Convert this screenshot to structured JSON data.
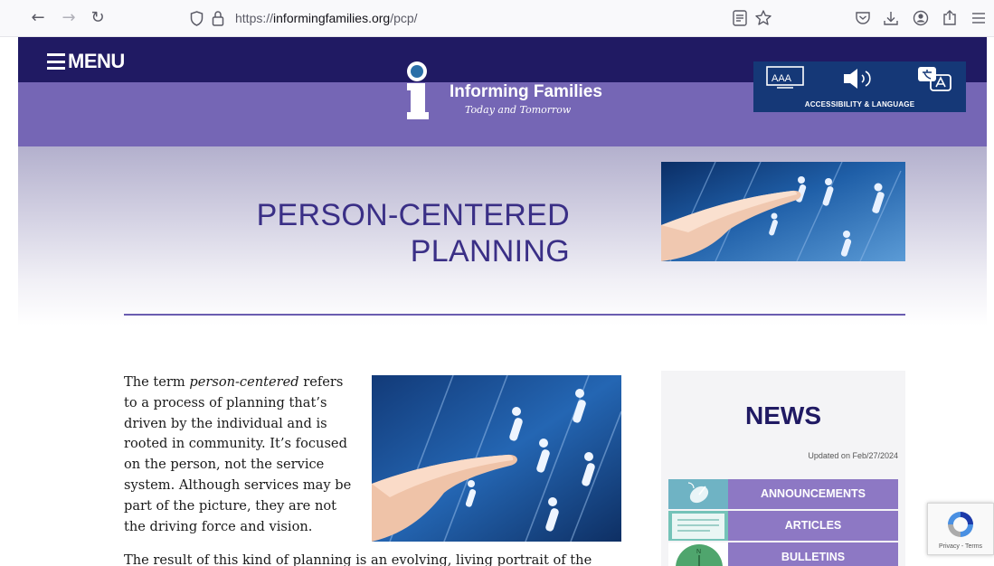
{
  "browser": {
    "url_prefix": "https://",
    "url_domain": "informingfamilies.org",
    "url_path": "/pcp/"
  },
  "site": {
    "menu_label": "MENU",
    "logo_name": "Informing Families",
    "logo_tagline": "Today and Tomorrow",
    "accessibility_label": "ACCESSIBILITY & LANGUAGE",
    "accessibility_icon_text": "AAA"
  },
  "hero": {
    "title_line1": "PERSON-CENTERED",
    "title_line2": "PLANNING"
  },
  "content": {
    "intro_before": "The term ",
    "intro_em": "person-centered",
    "intro_after": " refers to a process of planning that’s driven by the individual and is rooted in community. It’s focused on the person, not the service system. Although services may be part of the picture, they are not the driving force and vision.",
    "result_text": "The result of this kind of planning is an evolving, living portrait of the"
  },
  "news": {
    "title": "NEWS",
    "updated": "Updated on Feb/27/2024",
    "items": [
      {
        "label": "ANNOUNCEMENTS"
      },
      {
        "label": "ARTICLES"
      },
      {
        "label": "BULLETINS"
      }
    ]
  },
  "recaptcha": {
    "links": "Privacy - Terms"
  },
  "colors": {
    "header_dark": "#201a63",
    "header_purple": "#7566b5",
    "title_purple": "#3a2f86",
    "access_blue": "#153877",
    "news_button": "#8d78c4"
  }
}
